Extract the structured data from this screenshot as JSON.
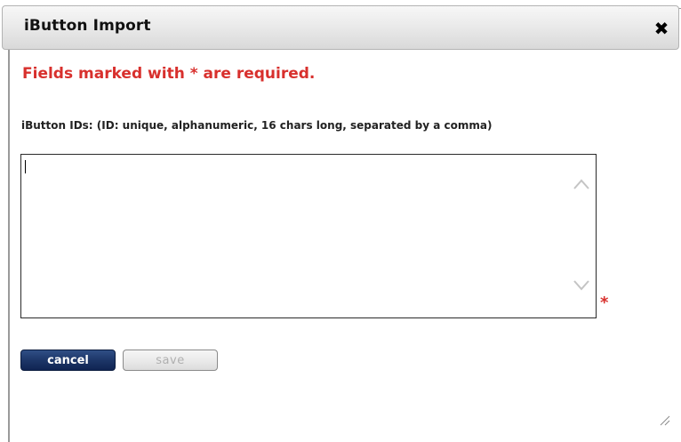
{
  "dialog": {
    "title": "iButton Import",
    "close_symbol": "✖",
    "required_note": "Fields marked with * are required.",
    "field_label": "iButton IDs: (ID: unique, alphanumeric, 16 chars long, separated by a comma)",
    "ids_value": "",
    "required_marker": "*",
    "cancel_label": "cancel",
    "save_label": "save"
  },
  "colors": {
    "required_red": "#d8302d",
    "cancel_blue": "#1d3668",
    "title_gradient_top": "#f7f7f7",
    "title_gradient_bottom": "#d9d9d9"
  },
  "icons": [
    "close-icon",
    "scroll-up-icon",
    "scroll-down-icon",
    "resize-grip-icon"
  ]
}
